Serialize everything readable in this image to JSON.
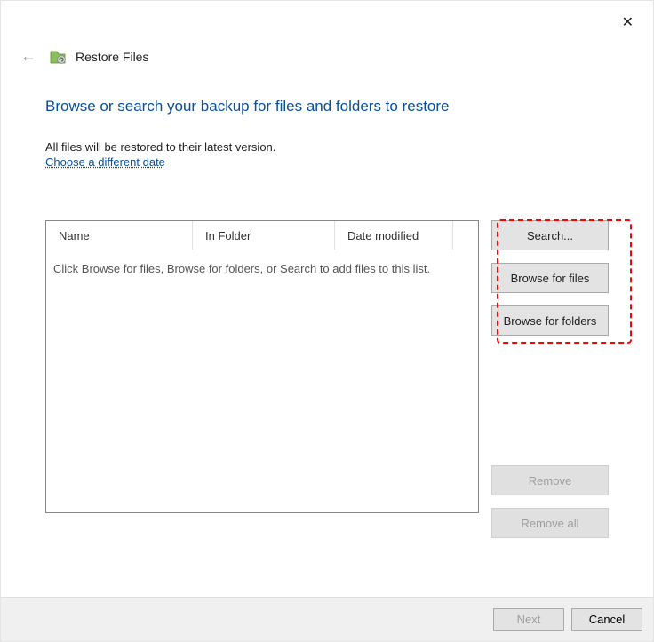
{
  "header": {
    "title": "Restore Files"
  },
  "instruction": "Browse or search your backup for files and folders to restore",
  "subtext": "All files will be restored to their latest version.",
  "link": "Choose a different date",
  "columns": {
    "name": "Name",
    "folder": "In Folder",
    "date": "Date modified"
  },
  "empty_message": "Click Browse for files, Browse for folders, or Search to add files to this list.",
  "buttons": {
    "search": "Search...",
    "browse_files": "Browse for files",
    "browse_folders": "Browse for folders",
    "remove": "Remove",
    "remove_all": "Remove all"
  },
  "footer": {
    "next": "Next",
    "cancel": "Cancel"
  }
}
